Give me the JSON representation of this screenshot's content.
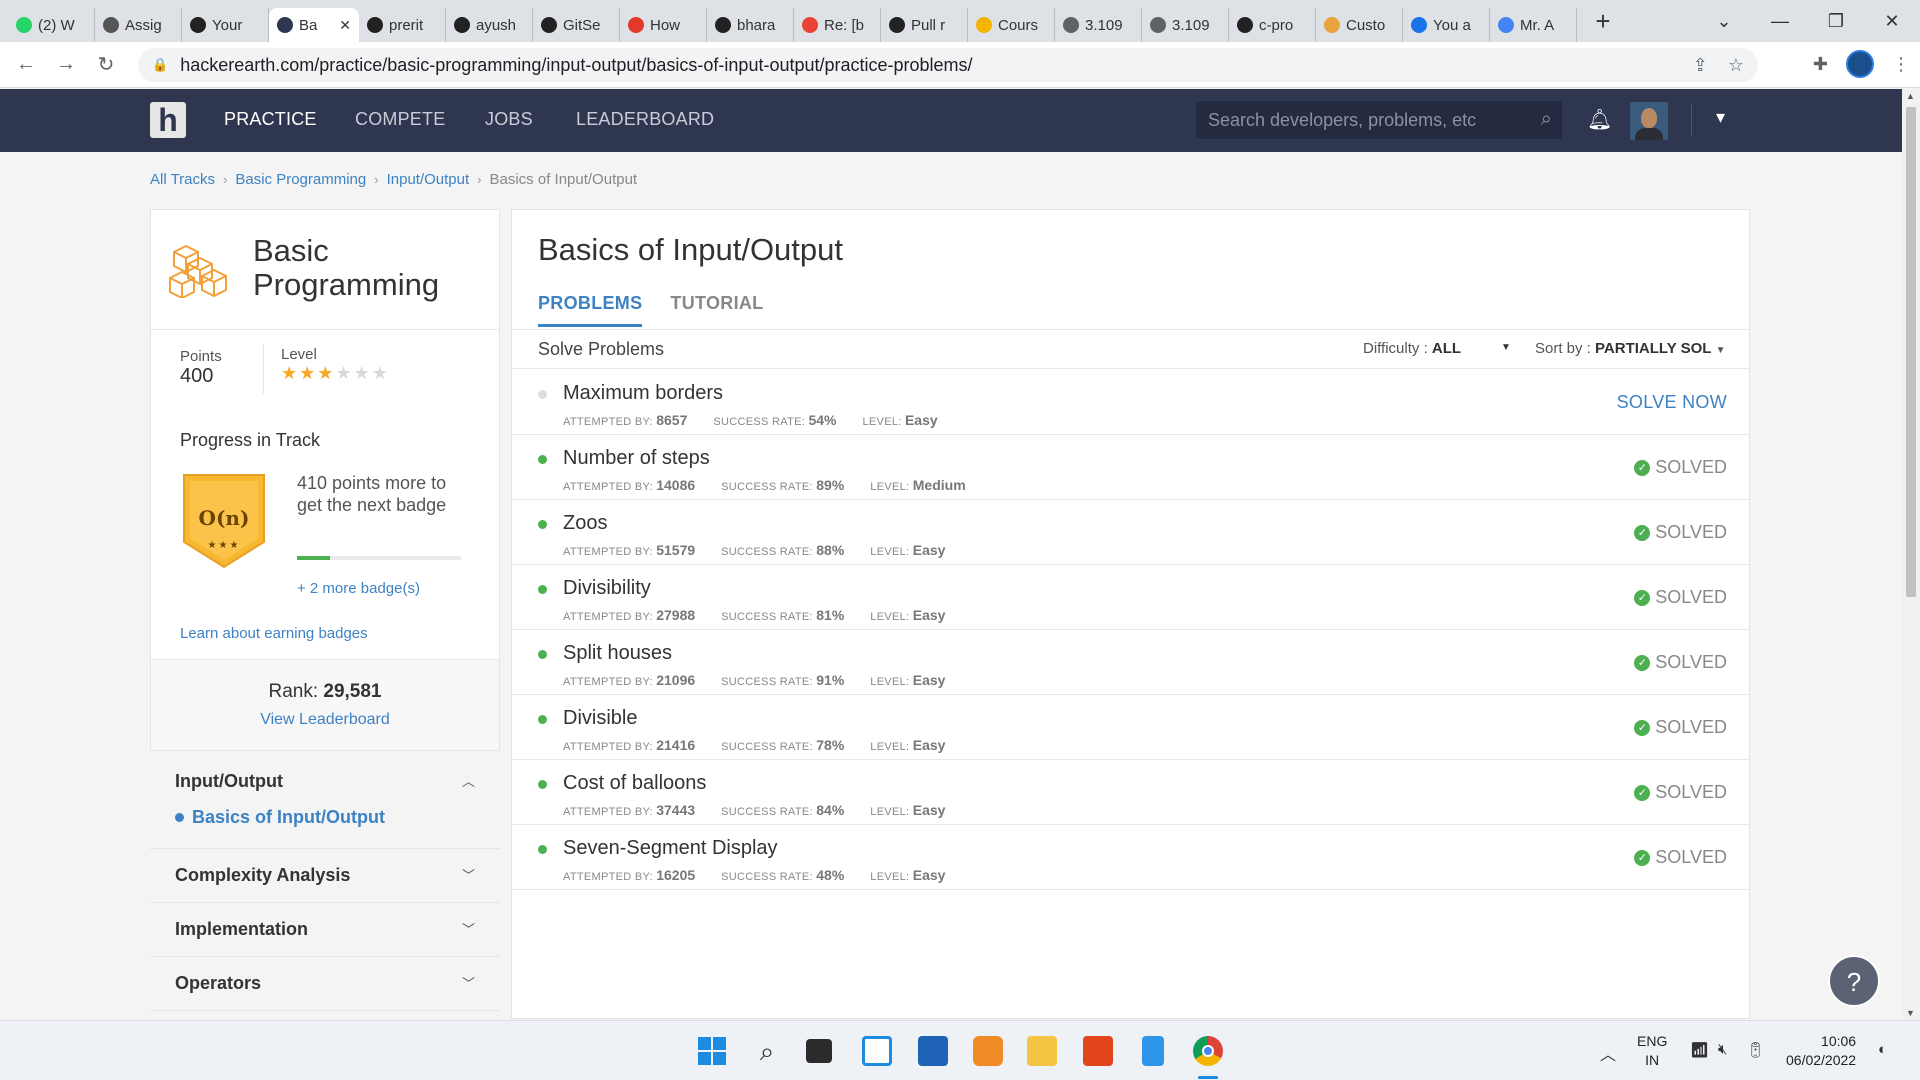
{
  "browser": {
    "tabs": [
      {
        "title": "(2) W",
        "favicon_color": "#25d366"
      },
      {
        "title": "Assig",
        "favicon_color": "#555555"
      },
      {
        "title": "Your",
        "favicon_color": "#222222"
      },
      {
        "title": "Ba",
        "favicon_color": "#2f3650",
        "active": true
      },
      {
        "title": "prerit",
        "favicon_color": "#222222"
      },
      {
        "title": "ayush",
        "favicon_color": "#222222"
      },
      {
        "title": "GitSe",
        "favicon_color": "#222222"
      },
      {
        "title": "How",
        "favicon_color": "#e23a2a"
      },
      {
        "title": "bhara",
        "favicon_color": "#222222"
      },
      {
        "title": "Re: [b",
        "favicon_color": "#ea4335"
      },
      {
        "title": "Pull r",
        "favicon_color": "#222222"
      },
      {
        "title": "Cours",
        "favicon_color": "#f4b400"
      },
      {
        "title": "3.109",
        "favicon_color": "#5f6368"
      },
      {
        "title": "3.109",
        "favicon_color": "#5f6368"
      },
      {
        "title": "c-pro",
        "favicon_color": "#222222"
      },
      {
        "title": "Custo",
        "favicon_color": "#e8a33d"
      },
      {
        "title": "You a",
        "favicon_color": "#1a73e8"
      },
      {
        "title": "Mr. A",
        "favicon_color": "#4285f4"
      }
    ],
    "new_tab": "+",
    "url": "hackerearth.com/practice/basic-programming/input-output/basics-of-input-output/practice-problems/"
  },
  "header": {
    "logo": "h",
    "nav": [
      "PRACTICE",
      "COMPETE",
      "JOBS",
      "LEADERBOARD"
    ],
    "search_placeholder": "Search developers, problems, etc"
  },
  "breadcrumb": {
    "items": [
      "All Tracks",
      "Basic Programming",
      "Input/Output"
    ],
    "current": "Basics of Input/Output"
  },
  "track": {
    "title": "Basic Programming",
    "points_label": "Points",
    "points": "400",
    "level_label": "Level",
    "level_stars": 3,
    "level_max": 6,
    "progress_title": "Progress in Track",
    "badge_text": "O(n)",
    "badge_stars": "★★★",
    "progress_text": "410 points more to get the next badge",
    "progress_fraction": 0.2,
    "more_badges": "+ 2 more badge(s)",
    "learn_badges": "Learn about earning badges",
    "rank_label": "Rank:",
    "rank": "29,581",
    "view_leaderboard": "View Leaderboard"
  },
  "sidebar_sections": [
    {
      "title": "Input/Output",
      "expanded": true,
      "items": [
        "Basics of Input/Output"
      ]
    },
    {
      "title": "Complexity Analysis",
      "expanded": false
    },
    {
      "title": "Implementation",
      "expanded": false
    },
    {
      "title": "Operators",
      "expanded": false
    }
  ],
  "main": {
    "title": "Basics of Input/Output",
    "tabs": [
      "PROBLEMS",
      "TUTORIAL"
    ],
    "solve_label": "Solve Problems",
    "difficulty_label": "Difficulty :",
    "difficulty_value": "ALL",
    "sort_label": "Sort by :",
    "sort_value": "PARTIALLY SOL",
    "meta_labels": {
      "attempted": "ATTEMPTED BY:",
      "success": "SUCCESS RATE:",
      "level": "LEVEL:"
    },
    "problems": [
      {
        "name": "Maximum borders",
        "attempted": "8657",
        "success": "54%",
        "level": "Easy",
        "status": "SOLVE NOW"
      },
      {
        "name": "Number of steps",
        "attempted": "14086",
        "success": "89%",
        "level": "Medium",
        "status": "SOLVED"
      },
      {
        "name": "Zoos",
        "attempted": "51579",
        "success": "88%",
        "level": "Easy",
        "status": "SOLVED"
      },
      {
        "name": "Divisibility",
        "attempted": "27988",
        "success": "81%",
        "level": "Easy",
        "status": "SOLVED"
      },
      {
        "name": "Split houses",
        "attempted": "21096",
        "success": "91%",
        "level": "Easy",
        "status": "SOLVED"
      },
      {
        "name": "Divisible",
        "attempted": "21416",
        "success": "78%",
        "level": "Easy",
        "status": "SOLVED"
      },
      {
        "name": "Cost of balloons",
        "attempted": "37443",
        "success": "84%",
        "level": "Easy",
        "status": "SOLVED"
      },
      {
        "name": "Seven-Segment Display",
        "attempted": "16205",
        "success": "48%",
        "level": "Easy",
        "status": "SOLVED"
      }
    ]
  },
  "help": "?",
  "taskbar": {
    "lang_top": "ENG",
    "lang_bottom": "IN",
    "time": "10:06",
    "date": "06/02/2022"
  },
  "colors": {
    "header_bg": "#2f3650",
    "accent": "#3d82c4",
    "solved_green": "#4caf50",
    "star": "#f6a724",
    "badge_gold": "#f7b731"
  }
}
